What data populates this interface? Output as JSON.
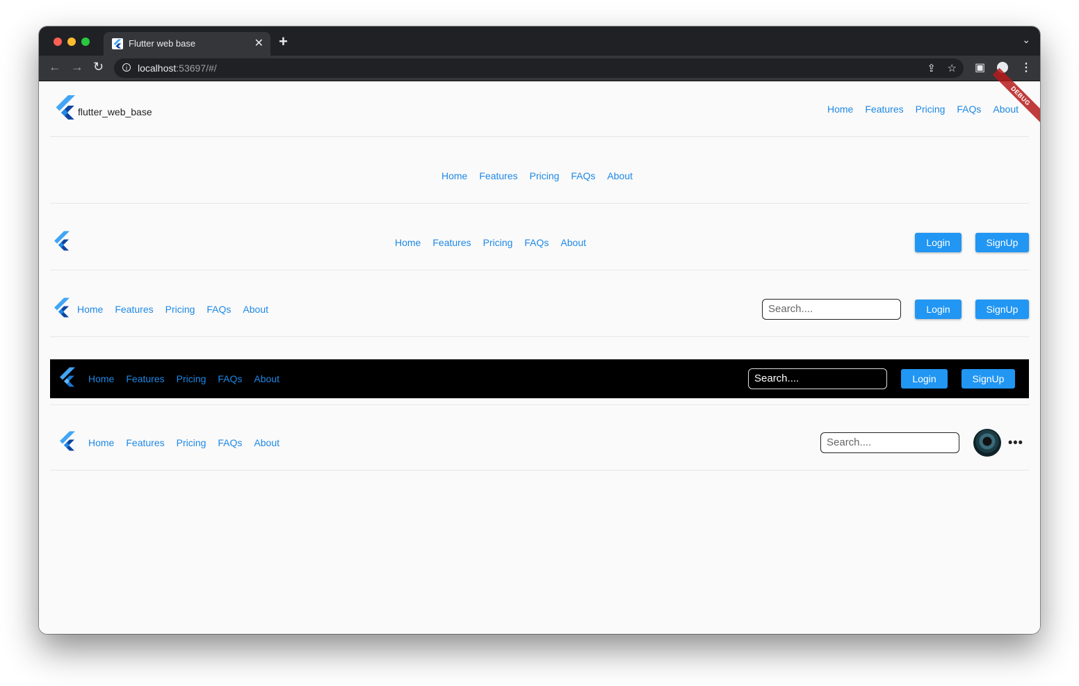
{
  "browser": {
    "tab_title": "Flutter web base",
    "url_host": "localhost",
    "url_rest": ":53697/#/"
  },
  "app": {
    "brand": "flutter_web_base",
    "debug_label": "DEBUG",
    "nav": [
      "Home",
      "Features",
      "Pricing",
      "FAQs",
      "About"
    ],
    "login_label": "Login",
    "signup_label": "SignUp",
    "search_placeholder": "Search....",
    "more_label": "•••"
  },
  "colors": {
    "link": "#1e88e5",
    "button": "#2196f3",
    "dark_bar": "#000000",
    "flutter_light": "#42a5f5",
    "flutter_dark": "#0d47a1"
  }
}
